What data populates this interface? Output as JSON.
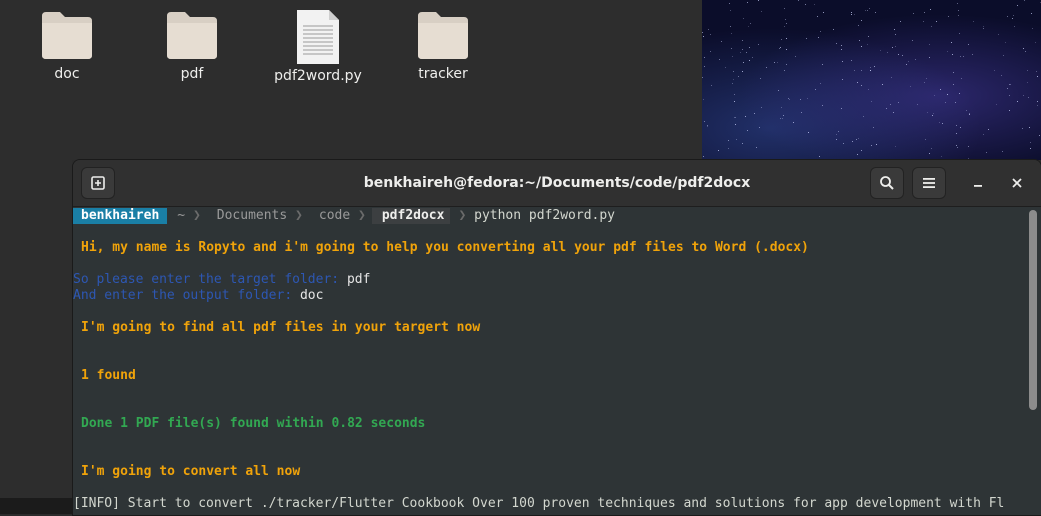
{
  "desktop": {
    "items": [
      {
        "label": "doc",
        "type": "folder"
      },
      {
        "label": "pdf",
        "type": "folder"
      },
      {
        "label": "pdf2word.py",
        "type": "file"
      },
      {
        "label": "tracker",
        "type": "folder"
      }
    ]
  },
  "terminal": {
    "title": "benkhaireh@fedora:~/Documents/code/pdf2docx",
    "prompt": {
      "user": "benkhaireh",
      "home": "~",
      "dir1": "Documents",
      "dir2": "code",
      "current": "pdf2docx",
      "separator": "❯",
      "command": "python pdf2word.py"
    },
    "lines": {
      "greeting": "Hi, my name is Ropyto and i'm going to help you converting all your pdf files to Word (.docx)",
      "target_prompt": "So please enter the target folder: ",
      "target_value": "pdf",
      "output_prompt": "And enter the output folder: ",
      "output_value": "doc",
      "finding": "I'm going to find all pdf files in your targert now",
      "found": "1 found",
      "done": "Done 1 PDF file(s) found within 0.82 seconds",
      "convert": "I'm going to convert all now",
      "info": "[INFO] Start to convert ./tracker/Flutter Cookbook Over 100 proven techniques and solutions for app development with Fl"
    }
  },
  "colors": {
    "terminal_bg": "#2e3436",
    "prompt_user_bg": "#1a7fa6",
    "orange": "#f0a30a",
    "blue": "#2d57b3",
    "green": "#32a852"
  },
  "icons": {
    "new_tab": "new-tab-icon",
    "search": "search-icon",
    "menu": "hamburger-menu-icon",
    "minimize": "minimize-icon",
    "close": "close-icon"
  }
}
